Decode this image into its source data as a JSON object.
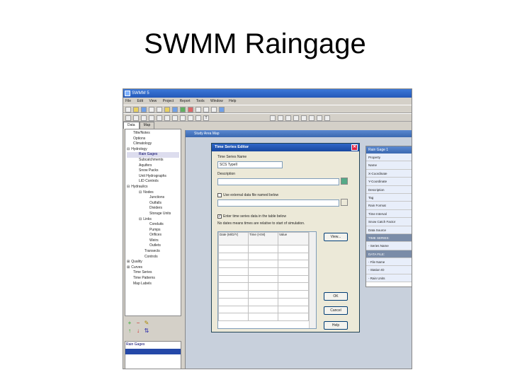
{
  "slide": {
    "title": "SWMM Raingage"
  },
  "app": {
    "title": "SWMM 5",
    "menu": [
      "File",
      "Edit",
      "View",
      "Project",
      "Report",
      "Tools",
      "Window",
      "Help"
    ]
  },
  "browser": {
    "tabs": [
      "Data",
      "Map"
    ],
    "tree": [
      {
        "label": "Title/Notes",
        "level": 1
      },
      {
        "label": "Options",
        "level": 1
      },
      {
        "label": "Climatology",
        "level": 1
      },
      {
        "label": "Hydrology",
        "level": 0,
        "expander": "⊟"
      },
      {
        "label": "Rain Gages",
        "level": 2,
        "selected": true
      },
      {
        "label": "Subcatchments",
        "level": 2
      },
      {
        "label": "Aquifers",
        "level": 2
      },
      {
        "label": "Snow Packs",
        "level": 2
      },
      {
        "label": "Unit Hydrographs",
        "level": 2
      },
      {
        "label": "LID Controls",
        "level": 2
      },
      {
        "label": "Hydraulics",
        "level": 0,
        "expander": "⊟"
      },
      {
        "label": "Nodes",
        "level": 2,
        "expander": "⊟"
      },
      {
        "label": "Junctions",
        "level": 4
      },
      {
        "label": "Outfalls",
        "level": 4
      },
      {
        "label": "Dividers",
        "level": 4
      },
      {
        "label": "Storage Units",
        "level": 4
      },
      {
        "label": "Links",
        "level": 2,
        "expander": "⊟"
      },
      {
        "label": "Conduits",
        "level": 4
      },
      {
        "label": "Pumps",
        "level": 4
      },
      {
        "label": "Orifices",
        "level": 4
      },
      {
        "label": "Weirs",
        "level": 4
      },
      {
        "label": "Outlets",
        "level": 4
      },
      {
        "label": "Transects",
        "level": 3
      },
      {
        "label": "Controls",
        "level": 3
      },
      {
        "label": "Quality",
        "level": 0,
        "expander": "⊞"
      },
      {
        "label": "Curves",
        "level": 0,
        "expander": "⊞"
      },
      {
        "label": "Time Series",
        "level": 1
      },
      {
        "label": "Time Patterns",
        "level": 1
      },
      {
        "label": "Map Labels",
        "level": 1
      }
    ],
    "buttons": [
      "+",
      "−",
      "✎",
      "↑",
      "↓",
      "⇅"
    ],
    "object_list_header": "Rain Gages"
  },
  "map": {
    "title": "Study Area Map"
  },
  "dialog": {
    "title": "Time Series Editor",
    "name_label": "Time Series Name",
    "name_value": "SCS TypeII",
    "description_label": "Description",
    "description_value": "",
    "external_label": "Use external data file named below",
    "external_value": "",
    "enter_label": "Enter time series data in the table below",
    "no_dates_note": "No dates means times are relative to start of simulation.",
    "col_date": "Date (M/D/Y)",
    "col_time": "Time (H:M)",
    "col_value": "Value",
    "view_button": "View...",
    "ok_button": "OK",
    "cancel_button": "Cancel",
    "help_button": "Help"
  },
  "properties": {
    "title": "Rain Gage 1",
    "rows": [
      {
        "label": "Property",
        "type": "row"
      },
      {
        "label": "Name",
        "type": "row"
      },
      {
        "label": "X-Coordinate",
        "type": "row"
      },
      {
        "label": "Y-Coordinate",
        "type": "row"
      },
      {
        "label": "Description",
        "type": "row"
      },
      {
        "label": "Tag",
        "type": "row"
      },
      {
        "label": "Rain Format",
        "type": "row"
      },
      {
        "label": "Time Interval",
        "type": "row"
      },
      {
        "label": "Snow Catch Factor",
        "type": "row"
      },
      {
        "label": "Data Source",
        "type": "row"
      },
      {
        "label": "TIME SERIES:",
        "type": "cat"
      },
      {
        "label": "- Series Name",
        "type": "row"
      },
      {
        "label": "DATA FILE:",
        "type": "cat"
      },
      {
        "label": "- File Name",
        "type": "row"
      },
      {
        "label": "- Station ID",
        "type": "row"
      },
      {
        "label": "- Rain Units",
        "type": "row"
      }
    ]
  }
}
